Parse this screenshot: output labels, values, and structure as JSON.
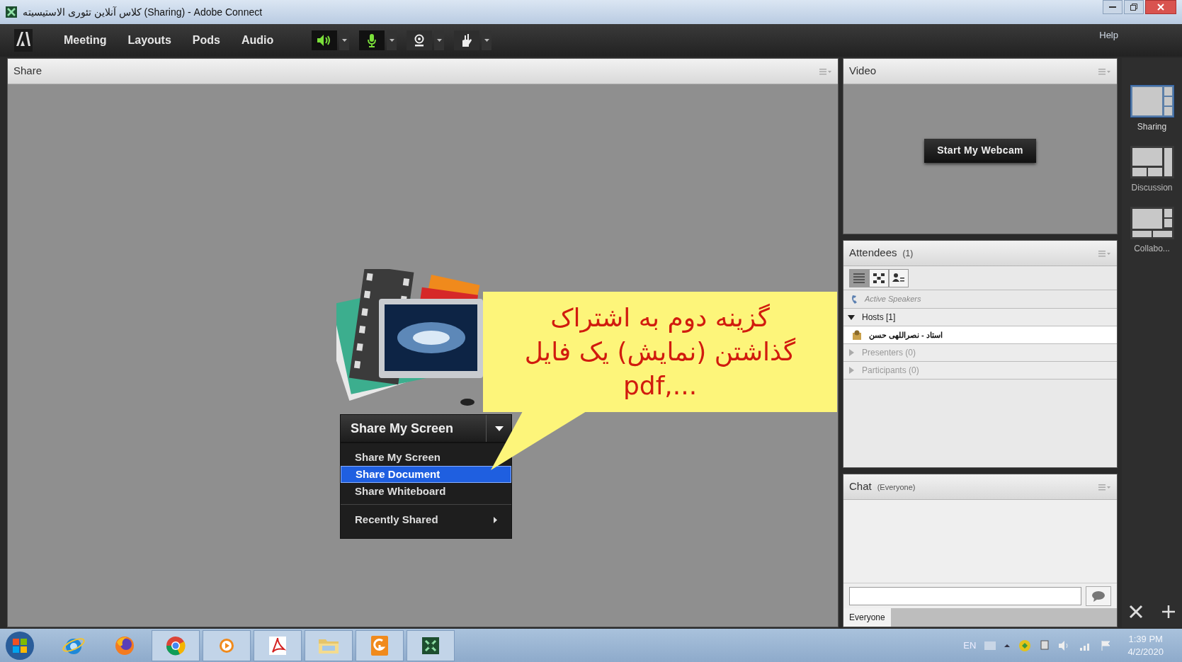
{
  "window": {
    "title": "کلاس آنلاین تئوری الاستیسیته (Sharing) - Adobe Connect"
  },
  "menu_bar": {
    "items": [
      "Meeting",
      "Layouts",
      "Pods",
      "Audio"
    ],
    "toolbar": [
      {
        "kind": "speaker",
        "on": true
      },
      {
        "kind": "mic",
        "on": true
      },
      {
        "kind": "camera",
        "on": false
      },
      {
        "kind": "hand",
        "on": false
      }
    ],
    "help": "Help"
  },
  "share_pod": {
    "title": "Share",
    "button": "Share My Screen",
    "menu": [
      {
        "label": "Share My Screen",
        "kind": "item",
        "selected": false
      },
      {
        "label": "Share Document",
        "kind": "item",
        "selected": true
      },
      {
        "label": "Share Whiteboard",
        "kind": "item",
        "selected": false
      },
      {
        "label": "Recently Shared",
        "kind": "submenu",
        "selected": false
      }
    ]
  },
  "callout": {
    "lines": [
      "گزینه دوم به اشتراک",
      "گذاشتن (نمایش) یک فایل",
      "pdf,..."
    ]
  },
  "video_pod": {
    "title": "Video",
    "button": "Start My Webcam"
  },
  "attendees_pod": {
    "title": "Attendees",
    "count": "(1)",
    "views": [
      {
        "kind": "list",
        "selected": true
      },
      {
        "kind": "grid",
        "selected": false
      },
      {
        "kind": "person",
        "selected": false
      }
    ],
    "active_speakers": "Active Speakers",
    "groups": [
      {
        "label": "Hosts [1]",
        "expanded": true,
        "children": [
          {
            "name": "استاد - نصراللهی حسن"
          }
        ]
      },
      {
        "label": "Presenters (0)",
        "expanded": false
      },
      {
        "label": "Participants (0)",
        "expanded": false
      }
    ]
  },
  "chat_pod": {
    "title": "Chat",
    "scope": "(Everyone)",
    "tab": "Everyone"
  },
  "layouts": [
    {
      "label": "Sharing",
      "selected": true
    },
    {
      "label": "Discussion",
      "selected": false
    },
    {
      "label": "Collabo...",
      "selected": false
    }
  ],
  "taskbar": {
    "apps": [
      {
        "kind": "ie",
        "running": false
      },
      {
        "kind": "firefox",
        "running": false
      },
      {
        "kind": "chrome",
        "running": true
      },
      {
        "kind": "media",
        "running": true
      },
      {
        "kind": "acrobat",
        "running": true
      },
      {
        "kind": "folder",
        "running": true
      },
      {
        "kind": "foxit",
        "running": true
      },
      {
        "kind": "connect",
        "running": true
      }
    ],
    "language": "EN",
    "time": "1:39 PM",
    "date": "4/2/2020"
  }
}
